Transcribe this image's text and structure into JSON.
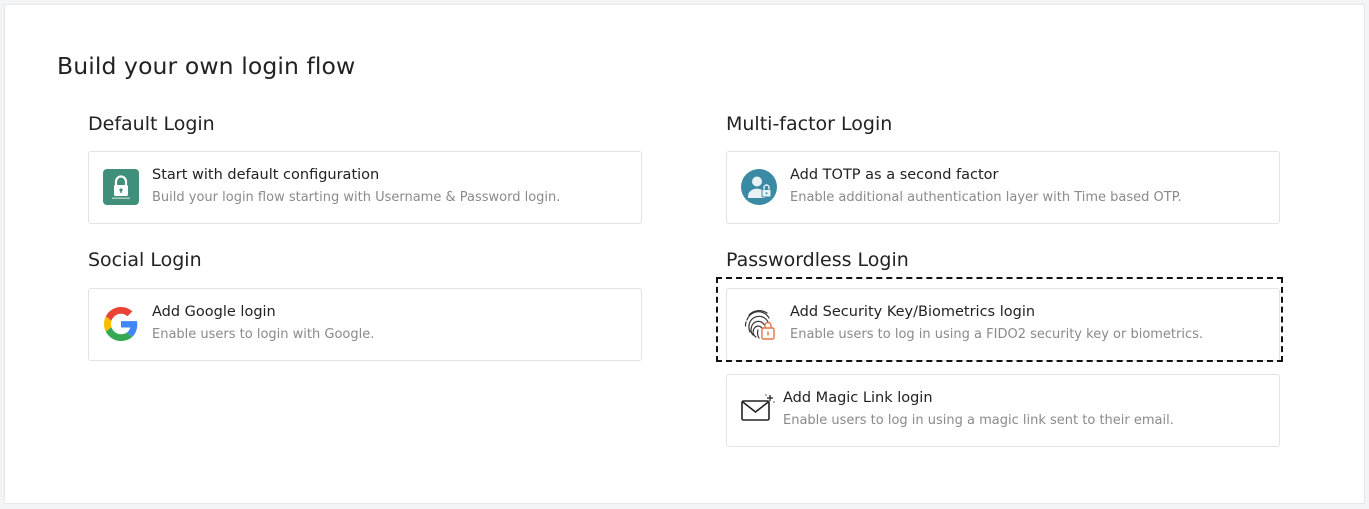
{
  "page": {
    "title": "Build your own login flow"
  },
  "sections": {
    "default_login": {
      "title": "Default Login",
      "card": {
        "title": "Start with default configuration",
        "description": "Build your login flow starting with Username & Password login.",
        "icon": "lock-icon",
        "icon_color": "#3f8f7a"
      }
    },
    "social_login": {
      "title": "Social Login",
      "card": {
        "title": "Add Google login",
        "description": "Enable users to login with Google.",
        "icon": "google-icon"
      }
    },
    "multi_factor_login": {
      "title": "Multi-factor Login",
      "card": {
        "title": "Add TOTP as a second factor",
        "description": "Enable additional authentication layer with Time based OTP.",
        "icon": "user-lock-icon",
        "icon_color": "#3a8aa3"
      }
    },
    "passwordless_login": {
      "title": "Passwordless Login",
      "cards": [
        {
          "title": "Add Security Key/Biometrics login",
          "description": "Enable users to log in using a FIDO2 security key or biometrics.",
          "icon": "fingerprint-icon",
          "highlighted": true,
          "accent_color": "#e5734a"
        },
        {
          "title": "Add Magic Link login",
          "description": "Enable users to log in using a magic link sent to their email.",
          "icon": "envelope-icon"
        }
      ]
    }
  }
}
